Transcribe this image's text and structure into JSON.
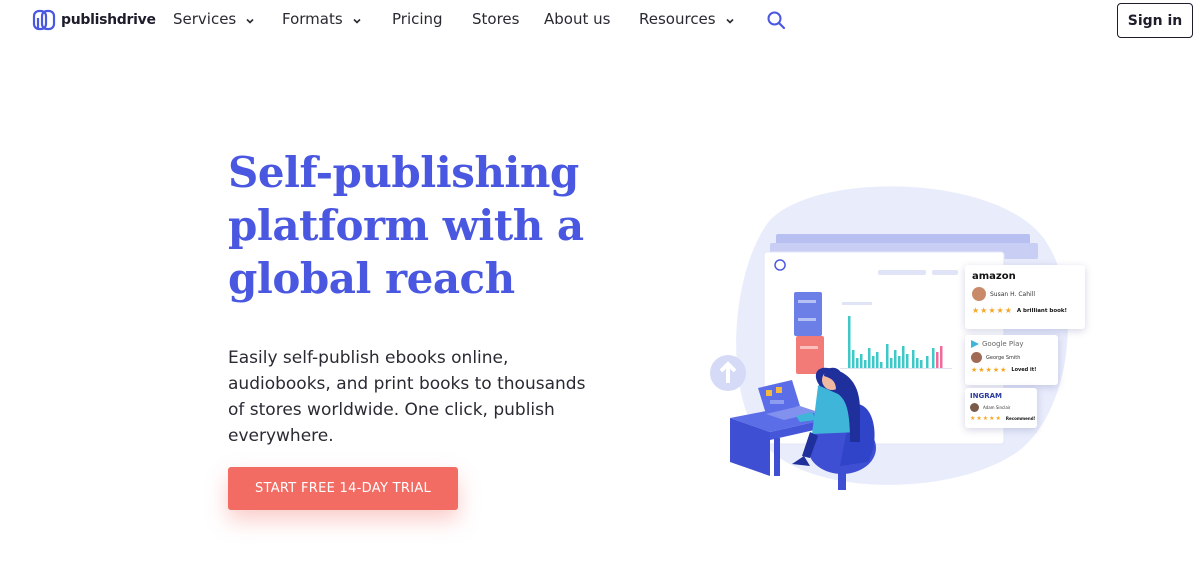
{
  "nav": {
    "logo_text": "publishdrive",
    "items": [
      {
        "label": "Services",
        "dropdown": true
      },
      {
        "label": "Formats",
        "dropdown": true
      },
      {
        "label": "Pricing",
        "dropdown": false
      },
      {
        "label": "Stores",
        "dropdown": false
      },
      {
        "label": "About us",
        "dropdown": false
      },
      {
        "label": "Resources",
        "dropdown": true
      }
    ],
    "search_icon": "search-icon",
    "signin_label": "Sign in"
  },
  "hero": {
    "title_lines": [
      "Self-publishing",
      "platform with a",
      "global reach"
    ],
    "description_lines": [
      "Easily self-publish ebooks online,",
      "audiobooks, and print books to thousands",
      "of stores worldwide. One click, publish",
      "everywhere."
    ],
    "cta_label": "START FREE 14-DAY TRIAL"
  },
  "illustration": {
    "reviews": [
      {
        "brand": "amazon",
        "user": "Susan H. Cahill",
        "stars": "★★★★★",
        "quote": "A brilliant book!"
      },
      {
        "brand": "Google Play",
        "user": "George Smith",
        "stars": "★★★★★",
        "quote": "Loved it!"
      },
      {
        "brand": "INGRAM",
        "user": "Adam Sinclair",
        "stars": "★★★★★",
        "quote": "Recommend!"
      }
    ]
  },
  "colors": {
    "brand_blue": "#4a57e0",
    "cta_coral": "#f26c64",
    "text_dark": "#2a2a33",
    "bar_teal": "#3fc8c8",
    "bar_pink": "#f06b9a"
  }
}
